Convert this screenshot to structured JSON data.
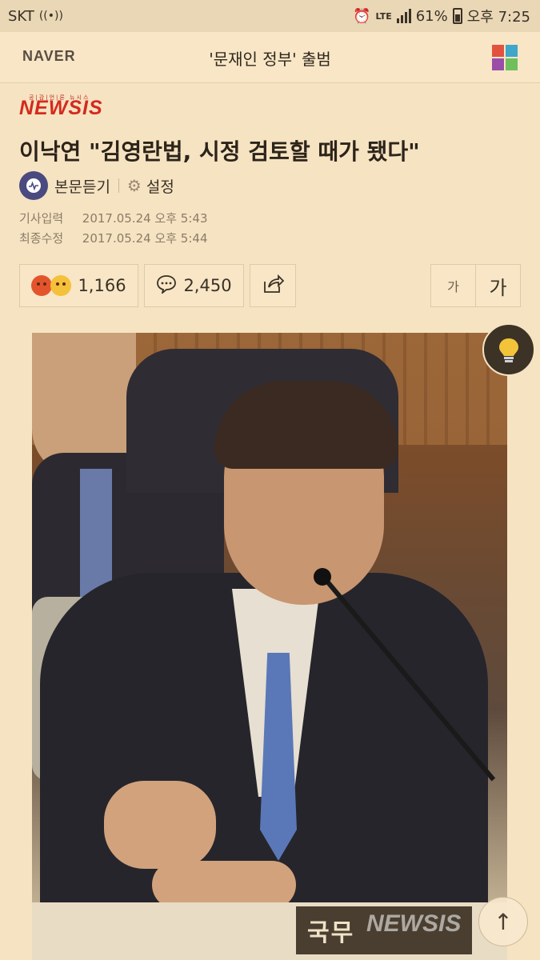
{
  "status_bar": {
    "carrier": "SKT",
    "network": "LTE",
    "battery": "61%",
    "time": "오후 7:25"
  },
  "header": {
    "logo": "NAVER",
    "title": "'문재인 정부' 출범",
    "menu_icon": "grid-menu-icon",
    "menu_colors": [
      "#e2533f",
      "#3fa7c9",
      "#9a4ea8",
      "#6fbf5c"
    ]
  },
  "article": {
    "press_logo": "NEWSIS",
    "press_sub": "공|감|언|론 뉴시스",
    "headline": "이낙연 \"김영란법, 시정 검토할 때가 됐다\"",
    "listen_label": "본문듣기",
    "settings_label": "설정",
    "published_label": "기사입력",
    "published_value": "2017.05.24 오후 5:43",
    "modified_label": "최종수정",
    "modified_value": "2017.05.24 오후 5:44"
  },
  "actions": {
    "reaction_count": "1,166",
    "comment_count": "2,450",
    "font_small": "가",
    "font_large": "가"
  },
  "photo": {
    "nameplate": "국무",
    "watermark": "NEWSIS"
  },
  "colors": {
    "background": "#f6e3c2",
    "press_red": "#d42a1e"
  }
}
